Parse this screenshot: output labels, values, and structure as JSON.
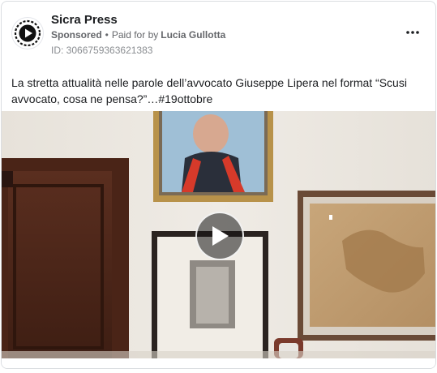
{
  "post": {
    "page_name": "Sicra Press",
    "sponsored_label": "Sponsored",
    "separator": "•",
    "paid_for_label": "Paid for by",
    "payer_name": "Lucia Gullotta",
    "ad_id": "ID: 3066759363621383",
    "caption": "La stretta attualità nelle parole dell’avvocato Giuseppe Lipera nel format “Scusi avvocato, cosa ne pensa?”…#19ottobre",
    "more_icon": "more-horizontal-icon",
    "avatar_icon": "sicra-press-logo",
    "media": {
      "type": "video",
      "play_icon": "play-icon"
    }
  },
  "colors": {
    "text_primary": "#1c1e21",
    "text_secondary": "#65676b",
    "border": "#dadde1"
  }
}
